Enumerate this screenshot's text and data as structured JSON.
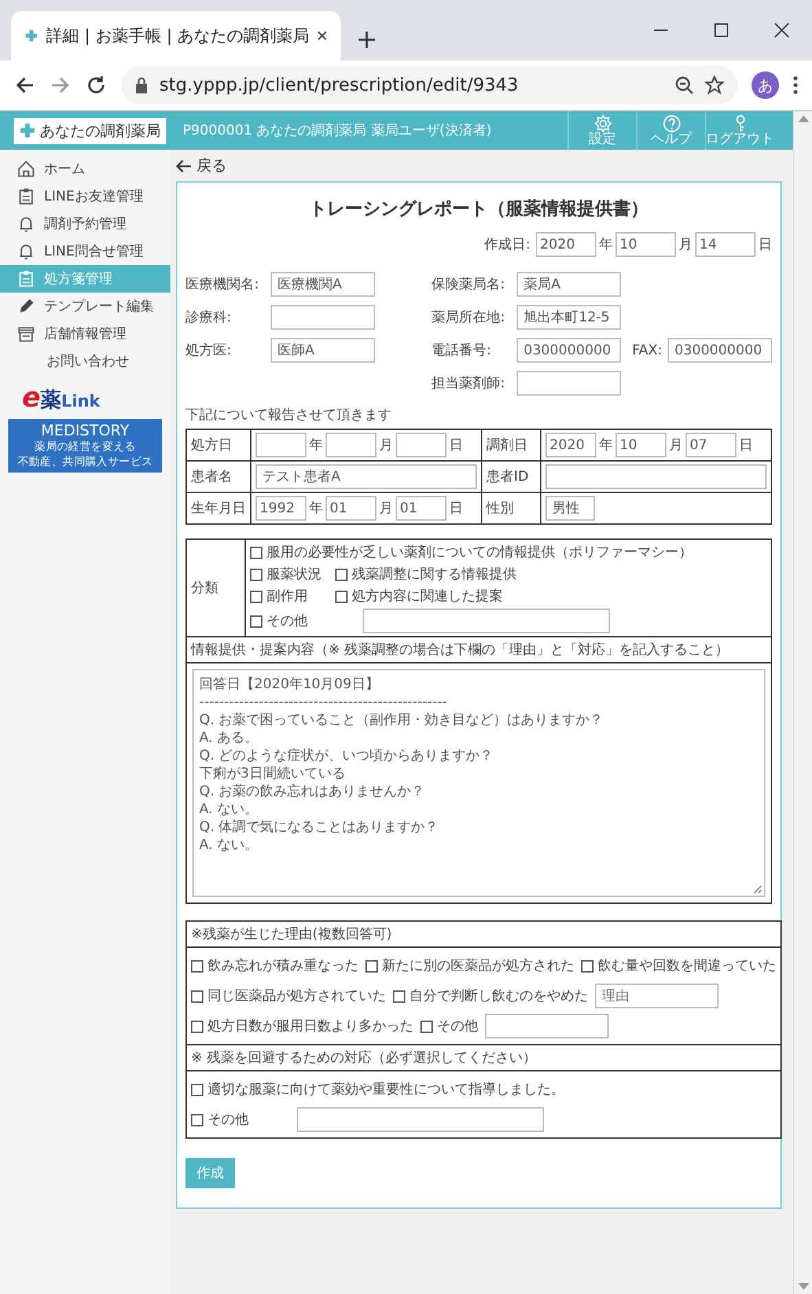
{
  "browser": {
    "tab_title": "詳細 | お薬手帳 | あなたの調剤薬局",
    "url": "stg.yppp.jp/client/prescription/edit/9343",
    "avatar": "あ"
  },
  "header": {
    "logo": "あなたの調剤薬局",
    "account": "P9000001 あなたの調剤薬局 薬局ユーザ(決済者)",
    "buttons": [
      {
        "label": "設定",
        "kind": "settings"
      },
      {
        "label": "ヘルプ",
        "kind": "help"
      },
      {
        "label": "ログアウト",
        "kind": "logout"
      }
    ]
  },
  "sidebar": {
    "items": [
      {
        "label": "ホーム",
        "selected": false
      },
      {
        "label": "LINEお友達管理",
        "selected": false
      },
      {
        "label": "調剤予約管理",
        "selected": false
      },
      {
        "label": "LINE問合せ管理",
        "selected": false
      },
      {
        "label": "処方箋管理",
        "selected": true
      },
      {
        "label": "テンプレート編集",
        "selected": false
      },
      {
        "label": "店舗情報管理",
        "selected": false
      },
      {
        "label": "お問い合わせ",
        "selected": false
      }
    ],
    "elink": [
      "e",
      "薬",
      "Link"
    ],
    "medistory": {
      "title": "MEDISTORY",
      "lines": [
        "薬局の経営を変える",
        "不動産、共同購入サービス"
      ]
    }
  },
  "back": "戻る",
  "report": {
    "title": "トレーシングレポート（服薬情報提供書）",
    "created": {
      "label": "作成日:",
      "parts": [
        {
          "value": "2020",
          "unit": "年"
        },
        {
          "value": "10",
          "unit": "月"
        },
        {
          "value": "14",
          "unit": "日"
        }
      ]
    },
    "left_fields": [
      {
        "label": "医療機関名:",
        "value": "医療機関A"
      },
      {
        "label": "診療科:"
      },
      {
        "label": "処方医:",
        "value": "医師A"
      }
    ],
    "right_fields": [
      {
        "label": "保険薬局名:",
        "value": "薬局A"
      },
      {
        "label": "薬局所在地:",
        "value": "旭出本町12-5"
      },
      {
        "label": "電話番号:",
        "value": "0300000000",
        "fax": {
          "label": "FAX:",
          "value": "0300000000"
        }
      },
      {
        "label": "担当薬剤師:"
      }
    ],
    "note": "下記について報告させて頂きます",
    "patient_rows": [
      [
        {
          "label": "処方日",
          "kind": "date",
          "parts": [
            {
              "unit": "年"
            },
            {
              "unit": "月"
            },
            {
              "unit": "日"
            }
          ]
        },
        {
          "label": "調剤日",
          "kind": "date",
          "parts": [
            {
              "value": "2020",
              "unit": "年"
            },
            {
              "value": "10",
              "unit": "月"
            },
            {
              "value": "07",
              "unit": "日"
            }
          ]
        }
      ],
      [
        {
          "label": "患者名",
          "kind": "text",
          "value": "テスト患者A"
        },
        {
          "label": "患者ID",
          "kind": "text"
        }
      ],
      [
        {
          "label": "生年月日",
          "kind": "date",
          "parts": [
            {
              "value": "1992",
              "unit": "年"
            },
            {
              "value": "01",
              "unit": "月"
            },
            {
              "value": "01",
              "unit": "日"
            }
          ]
        },
        {
          "label": "性別",
          "kind": "select",
          "value": "男性"
        }
      ]
    ],
    "category": {
      "label": "分類",
      "options": [
        {
          "label": "服用の必要性が乏しい薬剤についての情報提供（ポリファーマシー）",
          "checked": false
        },
        {
          "label": "服薬状況",
          "checked": false
        },
        {
          "label": "残薬調整に関する情報提供",
          "checked": false
        },
        {
          "label": "副作用",
          "checked": false
        },
        {
          "label": "処方内容に関連した提案",
          "checked": false
        }
      ],
      "other": {
        "label": "その他",
        "checked": false
      }
    },
    "info": {
      "heading": "情報提供・提案内容（※ 残薬調整の場合は下欄の「理由」と「対応」を記入すること）",
      "lines": [
        "回答日【2020年10月09日】",
        "--------------------------------------------------",
        "Q. お薬で困っていること（副作用・効き目など）はありますか？",
        "A. ある。",
        "Q. どのような症状が、いつ頃からありますか？",
        "下痢が3日間続いている",
        "Q. お薬の飲み忘れはありませんか？",
        "A. ない。",
        "Q. 体調で気になることはありますか？",
        "A. ない。"
      ]
    },
    "leftover": {
      "heading": "※残薬が生じた理由(複数回答可)",
      "option_lines": [
        [
          {
            "kind": "check",
            "label": "飲み忘れが積み重なった",
            "checked": false
          },
          {
            "kind": "check",
            "label": "新たに別の医薬品が処方された",
            "checked": false
          },
          {
            "kind": "check",
            "label": "飲む量や回数を間違っていた",
            "checked": false
          }
        ],
        [
          {
            "kind": "check",
            "label": "同じ医薬品が処方されていた",
            "checked": false
          },
          {
            "kind": "check",
            "label": "自分で判断し飲むのをやめた",
            "checked": false
          },
          {
            "kind": "field",
            "placeholder": "理由"
          }
        ],
        [
          {
            "kind": "check",
            "label": "処方日数が服用日数より多かった",
            "checked": false
          },
          {
            "kind": "check",
            "label": "その他",
            "checked": false
          },
          {
            "kind": "field"
          }
        ]
      ]
    },
    "avoid": {
      "heading": "※ 残薬を回避するための対応（必ず選択してください）",
      "option_lines": [
        [
          {
            "kind": "check",
            "label": "適切な服薬に向けて薬効や重要性について指導しました。",
            "checked": false
          }
        ],
        [
          {
            "kind": "check",
            "label": "その他",
            "checked": false
          },
          {
            "kind": "wide-field"
          }
        ]
      ]
    },
    "submit": "作成"
  }
}
